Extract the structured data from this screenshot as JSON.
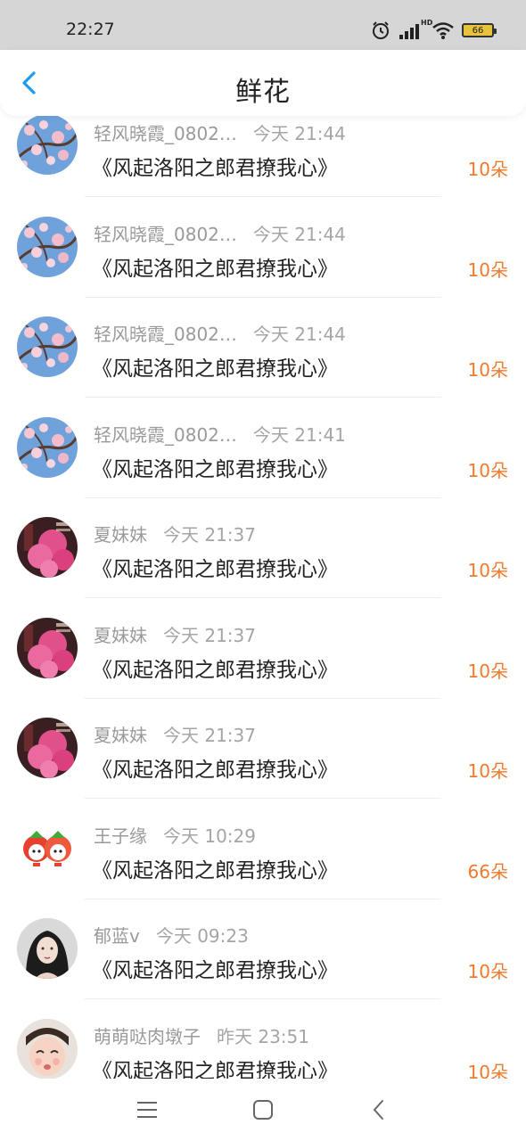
{
  "status_bar": {
    "time": "22:27",
    "hd": "HD",
    "battery": "66"
  },
  "header": {
    "title": "鲜花"
  },
  "records": [
    {
      "name": "轻风晓霞_0802…",
      "time": "今天 21:44",
      "book": "《风起洛阳之郎君撩我心》",
      "count": "10朵",
      "avatar": "blossom"
    },
    {
      "name": "轻风晓霞_0802…",
      "time": "今天 21:44",
      "book": "《风起洛阳之郎君撩我心》",
      "count": "10朵",
      "avatar": "blossom"
    },
    {
      "name": "轻风晓霞_0802…",
      "time": "今天 21:44",
      "book": "《风起洛阳之郎君撩我心》",
      "count": "10朵",
      "avatar": "blossom"
    },
    {
      "name": "轻风晓霞_0802…",
      "time": "今天 21:41",
      "book": "《风起洛阳之郎君撩我心》",
      "count": "10朵",
      "avatar": "blossom"
    },
    {
      "name": "夏妹妹",
      "time": "今天 21:37",
      "book": "《风起洛阳之郎君撩我心》",
      "count": "10朵",
      "avatar": "pinktree"
    },
    {
      "name": "夏妹妹",
      "time": "今天 21:37",
      "book": "《风起洛阳之郎君撩我心》",
      "count": "10朵",
      "avatar": "pinktree"
    },
    {
      "name": "夏妹妹",
      "time": "今天 21:37",
      "book": "《风起洛阳之郎君撩我心》",
      "count": "10朵",
      "avatar": "pinktree"
    },
    {
      "name": "王子缘",
      "time": "今天 10:29",
      "book": "《风起洛阳之郎君撩我心》",
      "count": "66朵",
      "avatar": "cartoon"
    },
    {
      "name": "郁蓝v",
      "time": "今天 09:23",
      "book": "《风起洛阳之郎君撩我心》",
      "count": "10朵",
      "avatar": "girl"
    },
    {
      "name": "萌萌哒肉墩子",
      "time": "昨天 23:51",
      "book": "《风起洛阳之郎君撩我心》",
      "count": "10朵",
      "avatar": "baby"
    }
  ],
  "colors": {
    "accent": "#f07a2c",
    "back_arrow": "#1e9bf0"
  },
  "icons": {
    "back": "chevron-left-icon",
    "menu": "menu-icon",
    "home": "home-square-icon",
    "nav_back": "nav-back-icon"
  }
}
